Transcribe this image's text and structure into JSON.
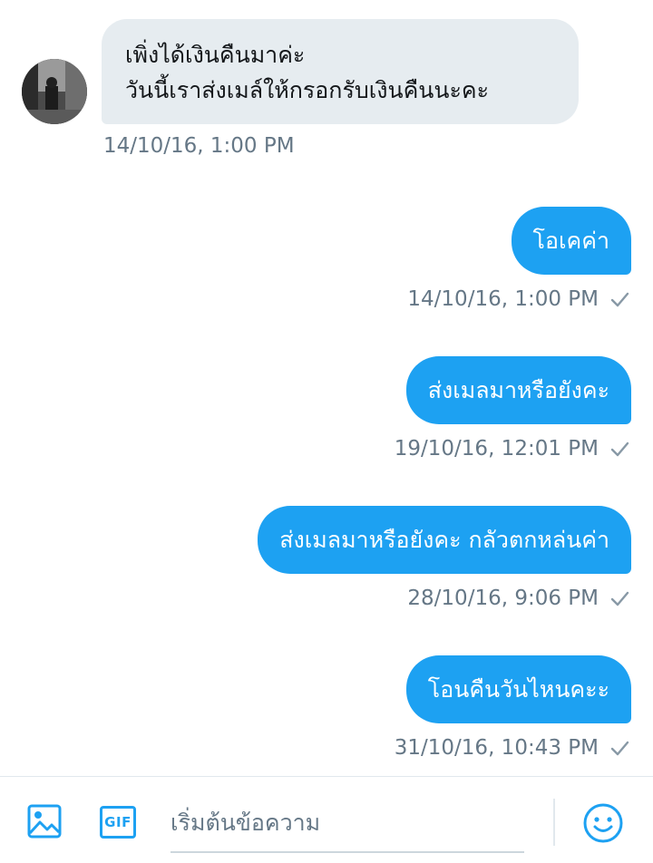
{
  "thread": {
    "incoming": {
      "lines": [
        "เพิ่งได้เงินคืนมาค่ะ",
        "วันนี้เราส่งเมล์ให้กรอกรับเงินคืนนะคะ"
      ],
      "timestamp": "14/10/16, 1:00 PM"
    },
    "outgoing": [
      {
        "text": "โอเคค่า",
        "timestamp": "14/10/16, 1:00 PM"
      },
      {
        "text": "ส่งเมลมาหรือยังคะ",
        "timestamp": "19/10/16, 12:01 PM"
      },
      {
        "text": "ส่งเมลมาหรือยังคะ กลัวตกหล่นค่า",
        "timestamp": "28/10/16, 9:06 PM"
      },
      {
        "text": "โอนคืนวันไหนคะะ",
        "timestamp": "31/10/16, 10:43 PM"
      }
    ]
  },
  "composer": {
    "placeholder": "เริ่มต้นข้อความ",
    "gif_label": "GIF",
    "icons": [
      "image-icon",
      "gif-icon",
      "emoji-icon"
    ]
  },
  "colors": {
    "accent": "#1da1f2",
    "incoming_bubble": "#e6ecf0",
    "timestamp": "#657786",
    "check": "#8899a6"
  }
}
